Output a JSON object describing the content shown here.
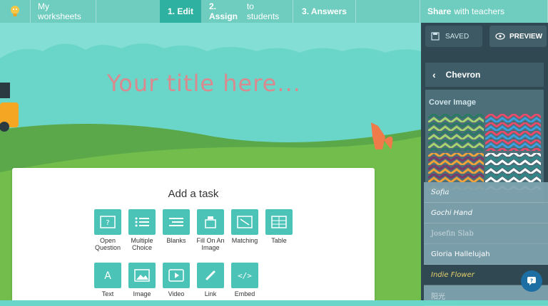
{
  "nav": {
    "my_worksheets": "My worksheets",
    "tabs": [
      {
        "label": "1. Edit",
        "sub": ""
      },
      {
        "label": "2. Assign",
        "sub": "to students"
      },
      {
        "label": "3. Answers",
        "sub": ""
      }
    ],
    "share": {
      "label": "Share",
      "sub": "with teachers"
    }
  },
  "canvas": {
    "title_placeholder": "Your title here..."
  },
  "add_task": {
    "heading": "Add a task",
    "tasks_row1": [
      "Open Question",
      "Multiple Choice",
      "Blanks",
      "Fill On An Image",
      "Matching",
      "Table"
    ],
    "tasks_row2": [
      "Text",
      "Image",
      "Video",
      "Link",
      "Embed"
    ]
  },
  "sidebar": {
    "saved_label": "SAVED",
    "preview_label": "PREVIEW",
    "theme_name": "Chevron",
    "cover_image_label": "Cover Image",
    "fonts": [
      "Sofia",
      "Gochi Hand",
      "Josefin Slab",
      "Gloria Hallelujah",
      "Indie Flower",
      "阳光"
    ],
    "selected_font": "Indie Flower"
  },
  "colors": {
    "accent": "#2fb1a2",
    "task_tile": "#4cc3b7",
    "panel": "#2f4852",
    "title_text": "#d98a8f"
  }
}
